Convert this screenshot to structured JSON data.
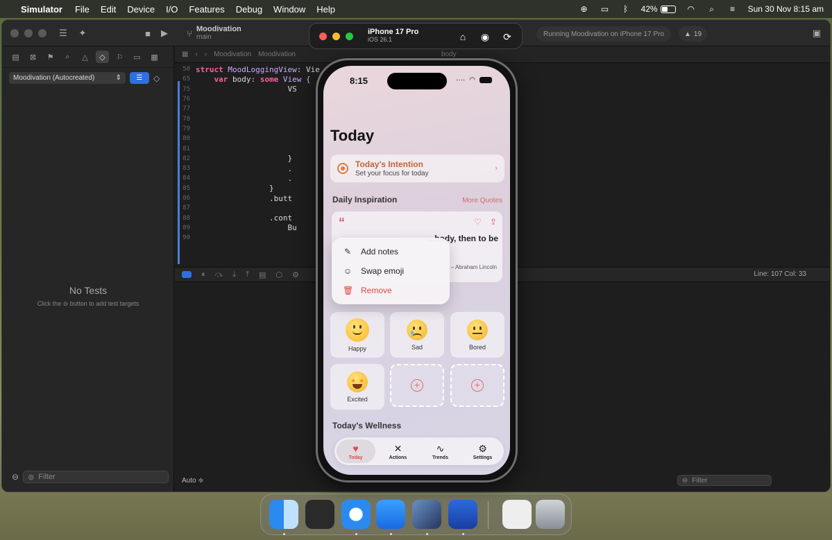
{
  "menubar": {
    "app_name": "Simulator",
    "items": [
      "File",
      "Edit",
      "Device",
      "I/O",
      "Features",
      "Debug",
      "Window",
      "Help"
    ],
    "battery_percent": "42%",
    "datetime": "Sun 30 Nov  8:15 am"
  },
  "xcode": {
    "project": "Moodivation",
    "branch": "main",
    "running_status": "Running Moodivation on iPhone 17 Pro",
    "warning_count": "19",
    "scheme_select": "Moodivation (Autocreated)",
    "jump_path": [
      "Moodivation",
      "Moodivation",
      "body"
    ],
    "no_tests_title": "No Tests",
    "no_tests_sub": "Click the ⊖ button to add test targets",
    "nav_filter_placeholder": "Filter",
    "line_col": "Line: 107  Col: 33",
    "auto_label": "Auto ≑",
    "console_filter_placeholder": "Filter",
    "code_lines": [
      {
        "ln": "58",
        "segments": [
          {
            "t": "struct ",
            "c": "kw"
          },
          {
            "t": "MoodLoggingView",
            "c": "ty"
          },
          {
            "t": ": Vie",
            "c": ""
          }
        ]
      },
      {
        "ln": "65",
        "segments": [
          {
            "t": "    var ",
            "c": "kw"
          },
          {
            "t": "body",
            "c": ""
          },
          {
            "t": ": some ",
            "c": "kw"
          },
          {
            "t": "View {",
            "c": "ty"
          }
        ]
      },
      {
        "ln": "75",
        "segments": [
          {
            "t": "                    VS",
            "c": ""
          }
        ]
      },
      {
        "ln": "76",
        "segments": []
      },
      {
        "ln": "77",
        "segments": []
      },
      {
        "ln": "78",
        "segments": []
      },
      {
        "ln": "79",
        "segments": []
      },
      {
        "ln": "80",
        "segments": []
      },
      {
        "ln": "81",
        "segments": []
      },
      {
        "ln": "82",
        "segments": [
          {
            "t": "                    }",
            "c": ""
          }
        ]
      },
      {
        "ln": "83",
        "segments": [
          {
            "t": "                    .",
            "c": ""
          }
        ]
      },
      {
        "ln": "84",
        "segments": [
          {
            "t": "                    .",
            "c": ""
          }
        ]
      },
      {
        "ln": "85",
        "segments": [
          {
            "t": "                }",
            "c": ""
          }
        ]
      },
      {
        "ln": "86",
        "segments": [
          {
            "t": "                .butt",
            "c": ""
          }
        ]
      },
      {
        "ln": "87",
        "segments": []
      },
      {
        "ln": "88",
        "segments": [
          {
            "t": "                .cont",
            "c": ""
          }
        ]
      },
      {
        "ln": "89",
        "segments": [
          {
            "t": "                    Bu",
            "c": ""
          }
        ]
      },
      {
        "ln": "90",
        "segments": []
      }
    ]
  },
  "simulator": {
    "device": "iPhone 17 Pro",
    "os": "iOS 26.1"
  },
  "app": {
    "time": "8:15",
    "title": "Today",
    "intention": {
      "title": "Today's Intention",
      "subtitle": "Set your focus for today"
    },
    "inspiration": {
      "title": "Daily Inspiration",
      "link": "More Quotes"
    },
    "quote": {
      "text": "...body, then to be",
      "author": "– Abraham Lincoln"
    },
    "context_menu": [
      {
        "label": "Add notes",
        "icon": "edit-note-icon",
        "destructive": false
      },
      {
        "label": "Swap emoji",
        "icon": "smiley-icon",
        "destructive": false
      },
      {
        "label": "Remove",
        "icon": "trash-icon",
        "destructive": true
      }
    ],
    "moods": [
      {
        "label": "Happy"
      },
      {
        "label": "Sad"
      },
      {
        "label": "Bored"
      },
      {
        "label": "Excited"
      }
    ],
    "wellness_title": "Today's Wellness",
    "tabs": [
      {
        "label": "Today",
        "icon": "heart-pulse-icon",
        "active": true
      },
      {
        "label": "Actions",
        "icon": "figure-icon",
        "active": false
      },
      {
        "label": "Trends",
        "icon": "waveform-icon",
        "active": false
      },
      {
        "label": "Settings",
        "icon": "gear-icon",
        "active": false
      }
    ]
  },
  "colors": {
    "accent_red": "#e0484a",
    "intention_orange": "#c0653a",
    "xcode_blue": "#2f6fe0"
  }
}
